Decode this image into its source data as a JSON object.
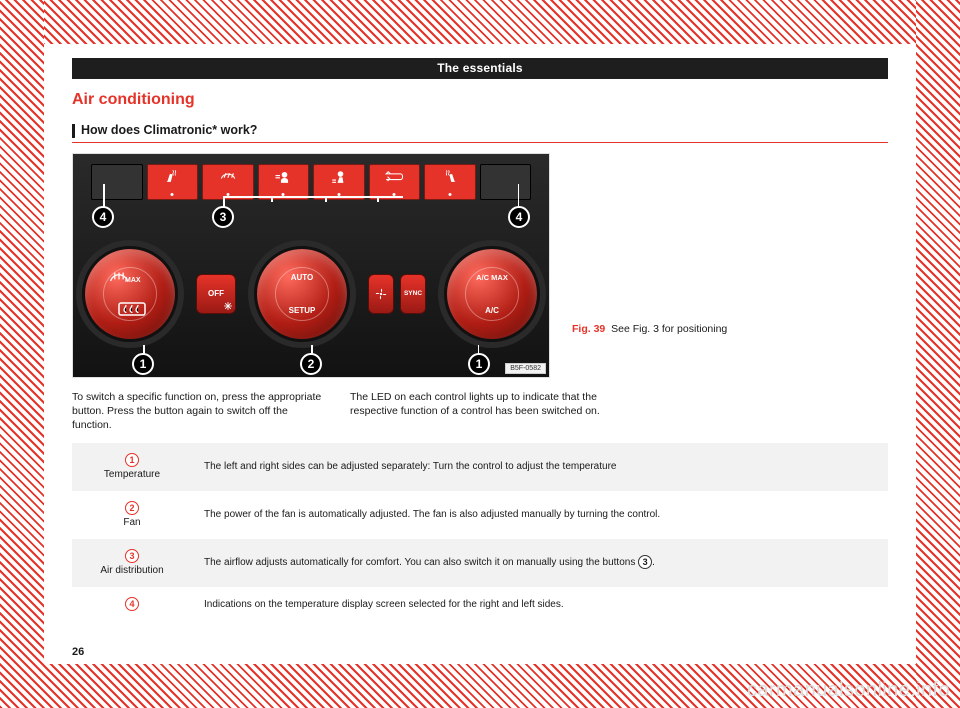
{
  "titlebar": "The essentials",
  "h1": "Air conditioning",
  "subhead": "How does Climatronic* work?",
  "fig": {
    "num": "Fig. 39",
    "caption": "See Fig. 3 for positioning",
    "code": "B5F-0582"
  },
  "intro": {
    "p1": "To switch a specific function on, press the appropriate button. Press the button again to switch off the function.",
    "p2": "The LED on each control lights up to indicate that the respective function of a control has been switched on."
  },
  "callouts": {
    "c1": "1",
    "c2": "2",
    "c3": "3",
    "c4": "4"
  },
  "dial_labels": {
    "left_top": "MAX",
    "center_top": "AUTO",
    "center_bottom": "SETUP",
    "right_top": "A/C MAX",
    "right_bottom": "A/C"
  },
  "mid_buttons": {
    "off": "OFF",
    "sync": "SYNC"
  },
  "table": {
    "r1": {
      "num": "1",
      "label": "Temperature",
      "desc": "The left and right sides can be adjusted separately: Turn the control to adjust the temperature"
    },
    "r2": {
      "num": "2",
      "label": "Fan",
      "desc": "The power of the fan is automatically adjusted. The fan is also adjusted manually by turning the control."
    },
    "r3": {
      "num": "3",
      "label": "Air distribution",
      "desc_a": "The airflow adjusts automatically for comfort. You can also switch it on manually using the buttons ",
      "desc_ref": "3",
      "desc_b": "."
    },
    "r4": {
      "num": "4",
      "desc": "Indications on the temperature display screen selected for the right and left sides."
    }
  },
  "pagenum": "26",
  "watermark": "carmanualsonline.info"
}
